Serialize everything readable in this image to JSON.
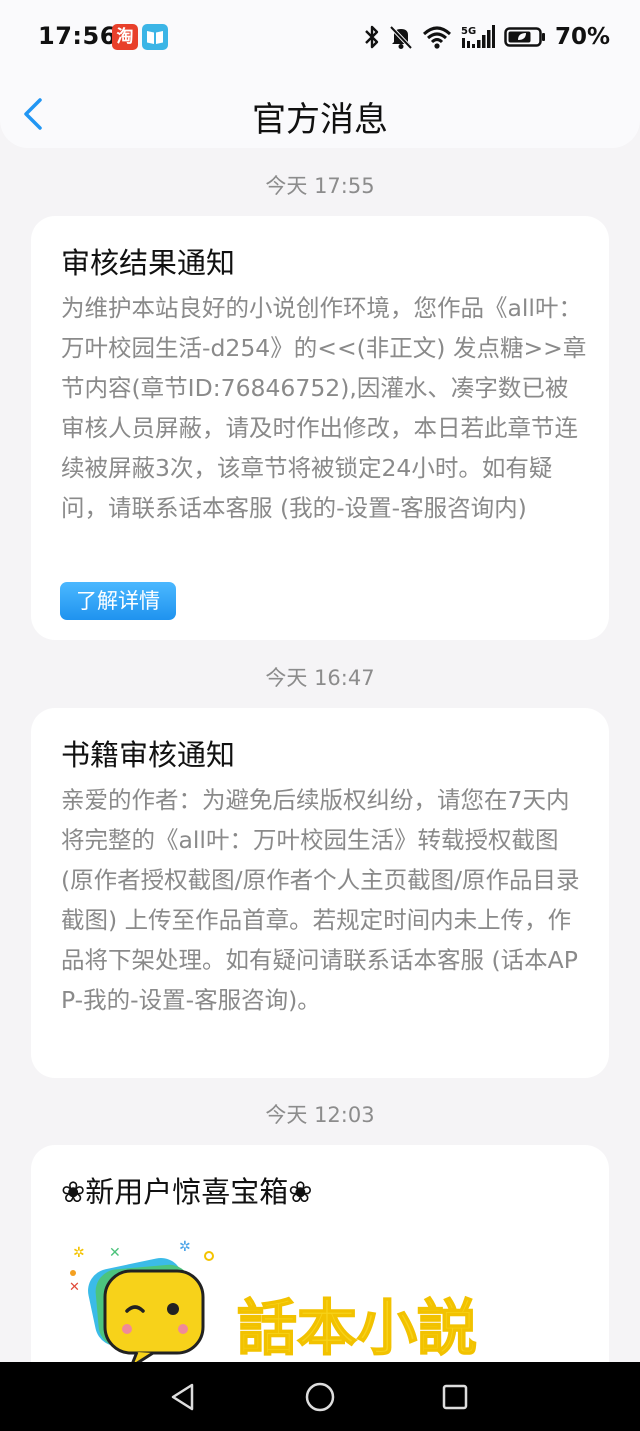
{
  "status_bar": {
    "time": "17:56",
    "app_icon_1": "淘",
    "app_icon_2": "📖",
    "network": "5G",
    "battery": "70%"
  },
  "header": {
    "title": "官方消息",
    "back_icon": "chevron-left-icon"
  },
  "messages": [
    {
      "timestamp": "今天 17:55",
      "title": "审核结果通知",
      "body": "为维护本站良好的小说创作环境，您作品《all叶：万叶校园生活-d254》的<<(非正文) 发点糖>>章节内容(章节ID:76846752),因灌水、凑字数已被审核人员屏蔽，请及时作出修改，本日若此章节连续被屏蔽3次，该章节将被锁定24小时。如有疑问，请联系话本客服 (我的-设置-客服咨询内)",
      "button_label": "了解详情"
    },
    {
      "timestamp": "今天 16:47",
      "title": "书籍审核通知",
      "body": "亲爱的作者：为避免后续版权纠纷，请您在7天内将完整的《all叶：万叶校园生活》转载授权截图 (原作者授权截图/原作者个人主页截图/原作品目录截图) 上传至作品首章。若规定时间内未上传，作品将下架处理。如有疑问请联系话本客服 (话本APP-我的-设置-客服咨询)。"
    },
    {
      "timestamp": "今天 12:03",
      "title": "❀新用户惊喜宝箱❀",
      "banner_text": "話本小説"
    }
  ],
  "colors": {
    "accent": "#2196f3",
    "button": "#1f93ef",
    "banner_yellow": "#f7d21a"
  }
}
